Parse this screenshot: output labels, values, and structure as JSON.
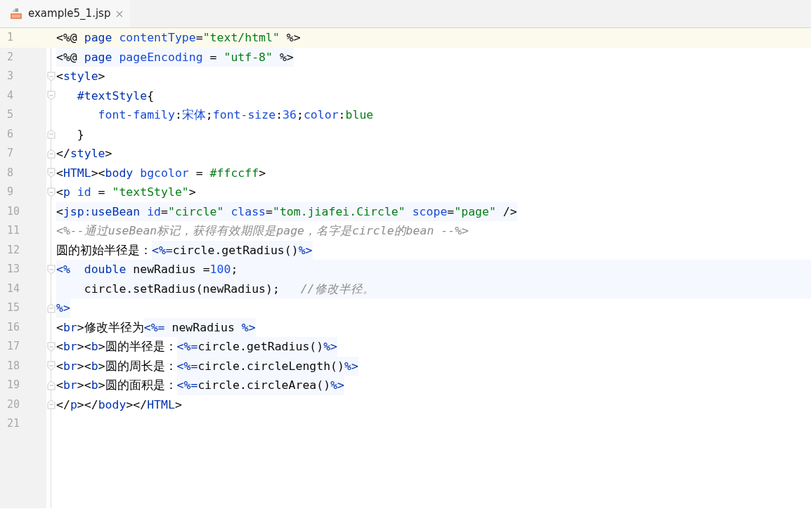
{
  "tabs": [
    {
      "label": "example5_1.jsp",
      "selected": true
    }
  ],
  "lines": [
    {
      "number": "1",
      "current": true,
      "block": false,
      "fold_start": false,
      "fold_end": false,
      "code": [
        {
          "text": "<%@ ",
          "kind": "plain"
        },
        {
          "text": "page ",
          "kind": "tag"
        },
        {
          "text": "contentType",
          "kind": "attr"
        },
        {
          "text": "=",
          "kind": "plain"
        },
        {
          "text": "\"text/html\"",
          "kind": "str"
        },
        {
          "text": " %>",
          "kind": "plain"
        }
      ]
    },
    {
      "number": "2",
      "current": false,
      "block": false,
      "fold_start": false,
      "fold_end": false,
      "injected": [
        {
          "text": "<%@ ",
          "kind": "plain"
        },
        {
          "text": "page ",
          "kind": "tag"
        },
        {
          "text": "pageEncoding",
          "kind": "attr"
        },
        {
          "text": " = ",
          "kind": "plain"
        },
        {
          "text": "\"utf-8\"",
          "kind": "str"
        },
        {
          "text": " %>",
          "kind": "plain"
        }
      ]
    },
    {
      "number": "3",
      "current": false,
      "block": false,
      "fold_start": true,
      "fold_end": false,
      "code": [
        {
          "text": "<",
          "kind": "plain"
        },
        {
          "text": "style",
          "kind": "tag"
        },
        {
          "text": ">",
          "kind": "plain"
        }
      ]
    },
    {
      "number": "4",
      "current": false,
      "block": false,
      "fold_start": true,
      "fold_end": false,
      "code": [
        {
          "text": "   #textStyle",
          "kind": "tag"
        },
        {
          "text": "{",
          "kind": "plain"
        }
      ]
    },
    {
      "number": "5",
      "current": false,
      "block": false,
      "fold_start": false,
      "fold_end": false,
      "code": [
        {
          "text": "      font-family",
          "kind": "attr"
        },
        {
          "text": ":",
          "kind": "plain"
        },
        {
          "text": "宋体",
          "kind": "attr"
        },
        {
          "text": ";",
          "kind": "plain"
        },
        {
          "text": "font-size",
          "kind": "attr"
        },
        {
          "text": ":",
          "kind": "plain"
        },
        {
          "text": "36",
          "kind": "num"
        },
        {
          "text": ";",
          "kind": "plain"
        },
        {
          "text": "color",
          "kind": "attr"
        },
        {
          "text": ":",
          "kind": "plain"
        },
        {
          "text": "blue",
          "kind": "str"
        }
      ]
    },
    {
      "number": "6",
      "current": false,
      "block": false,
      "fold_start": false,
      "fold_end": true,
      "code": [
        {
          "text": "   }",
          "kind": "plain"
        }
      ]
    },
    {
      "number": "7",
      "current": false,
      "block": false,
      "fold_start": false,
      "fold_end": true,
      "code": [
        {
          "text": "</",
          "kind": "plain"
        },
        {
          "text": "style",
          "kind": "tag"
        },
        {
          "text": ">",
          "kind": "plain"
        }
      ]
    },
    {
      "number": "8",
      "current": false,
      "block": false,
      "fold_start": true,
      "fold_end": false,
      "code": [
        {
          "text": "<",
          "kind": "plain"
        },
        {
          "text": "HTML",
          "kind": "tag"
        },
        {
          "text": "><",
          "kind": "plain"
        },
        {
          "text": "body ",
          "kind": "tag"
        },
        {
          "text": "bgcolor",
          "kind": "attr"
        },
        {
          "text": " = ",
          "kind": "plain"
        },
        {
          "text": "#ffccff",
          "kind": "str"
        },
        {
          "text": ">",
          "kind": "plain"
        }
      ]
    },
    {
      "number": "9",
      "current": false,
      "block": false,
      "fold_start": true,
      "fold_end": false,
      "code": [
        {
          "text": "<",
          "kind": "plain"
        },
        {
          "text": "p ",
          "kind": "tag"
        },
        {
          "text": "id",
          "kind": "attr"
        },
        {
          "text": " = ",
          "kind": "plain"
        },
        {
          "text": "\"textStyle\"",
          "kind": "str"
        },
        {
          "text": ">",
          "kind": "plain"
        }
      ]
    },
    {
      "number": "10",
      "current": false,
      "block": false,
      "fold_start": false,
      "fold_end": false,
      "injected": [
        {
          "text": "<",
          "kind": "plain"
        },
        {
          "text": "jsp:useBean ",
          "kind": "tag"
        },
        {
          "text": "id",
          "kind": "attr"
        },
        {
          "text": "=",
          "kind": "plain"
        },
        {
          "text": "\"circle\" ",
          "kind": "str"
        },
        {
          "text": "class",
          "kind": "attr"
        },
        {
          "text": "=",
          "kind": "plain"
        },
        {
          "text": "\"tom.jiafei.Circle\" ",
          "kind": "str"
        },
        {
          "text": "scope",
          "kind": "attr"
        },
        {
          "text": "=",
          "kind": "plain"
        },
        {
          "text": "\"page\"",
          "kind": "str"
        },
        {
          "text": " />",
          "kind": "plain"
        }
      ]
    },
    {
      "number": "11",
      "current": false,
      "block": false,
      "fold_start": false,
      "fold_end": false,
      "code": [
        {
          "text": "<%--通过useBean标记，获得有效期限是page，名字是circle的bean --%>",
          "kind": "comment"
        }
      ]
    },
    {
      "number": "12",
      "current": false,
      "block": false,
      "fold_start": false,
      "fold_end": false,
      "code": [
        {
          "text": "圆的初始半径是：",
          "kind": "plain"
        }
      ],
      "injected": [
        {
          "text": "<%=",
          "kind": "jsp"
        },
        {
          "text": "circle.getRadius()",
          "kind": "plain"
        },
        {
          "text": "%>",
          "kind": "jsp"
        }
      ]
    },
    {
      "number": "13",
      "current": false,
      "block": true,
      "fold_start": true,
      "fold_end": false,
      "code": [
        {
          "text": "<%  ",
          "kind": "jsp"
        },
        {
          "text": "double ",
          "kind": "tag"
        },
        {
          "text": "newRadius =",
          "kind": "plain"
        },
        {
          "text": "100",
          "kind": "num"
        },
        {
          "text": ";",
          "kind": "plain"
        }
      ]
    },
    {
      "number": "14",
      "current": false,
      "block": true,
      "fold_start": false,
      "fold_end": false,
      "code": [
        {
          "text": "    circle.setRadius(newRadius);   ",
          "kind": "plain"
        },
        {
          "text": "//修改半径。",
          "kind": "comment"
        }
      ]
    },
    {
      "number": "15",
      "current": false,
      "block": false,
      "fold_start": false,
      "fold_end": true,
      "injected": [
        {
          "text": "%>",
          "kind": "jsp"
        }
      ]
    },
    {
      "number": "16",
      "current": false,
      "block": false,
      "fold_start": false,
      "fold_end": false,
      "code": [
        {
          "text": "<",
          "kind": "plain"
        },
        {
          "text": "br",
          "kind": "tag"
        },
        {
          "text": ">修改半径为",
          "kind": "plain"
        }
      ],
      "injected": [
        {
          "text": "<%=",
          "kind": "jsp"
        },
        {
          "text": " newRadius ",
          "kind": "plain"
        },
        {
          "text": "%>",
          "kind": "jsp"
        }
      ]
    },
    {
      "number": "17",
      "current": false,
      "block": false,
      "fold_start": true,
      "fold_end": false,
      "code": [
        {
          "text": "<",
          "kind": "plain"
        },
        {
          "text": "br",
          "kind": "tag"
        },
        {
          "text": "><",
          "kind": "plain"
        },
        {
          "text": "b",
          "kind": "tag"
        },
        {
          "text": ">圆的半径是：",
          "kind": "plain"
        }
      ],
      "injected": [
        {
          "text": "<%=",
          "kind": "jsp"
        },
        {
          "text": "circle.getRadius()",
          "kind": "plain"
        },
        {
          "text": "%>",
          "kind": "jsp"
        }
      ]
    },
    {
      "number": "18",
      "current": false,
      "block": false,
      "fold_start": true,
      "fold_end": false,
      "code": [
        {
          "text": "<",
          "kind": "plain"
        },
        {
          "text": "br",
          "kind": "tag"
        },
        {
          "text": "><",
          "kind": "plain"
        },
        {
          "text": "b",
          "kind": "tag"
        },
        {
          "text": ">圆的周长是：",
          "kind": "plain"
        }
      ],
      "injected": [
        {
          "text": "<%=",
          "kind": "jsp"
        },
        {
          "text": "circle.circleLength()",
          "kind": "plain"
        },
        {
          "text": "%>",
          "kind": "jsp"
        }
      ]
    },
    {
      "number": "19",
      "current": false,
      "block": false,
      "fold_start": false,
      "fold_end": true,
      "code": [
        {
          "text": "<",
          "kind": "plain"
        },
        {
          "text": "br",
          "kind": "tag"
        },
        {
          "text": "><",
          "kind": "plain"
        },
        {
          "text": "b",
          "kind": "tag"
        },
        {
          "text": ">圆的面积是：",
          "kind": "plain"
        }
      ],
      "injected": [
        {
          "text": "<%=",
          "kind": "jsp"
        },
        {
          "text": "circle.circleArea()",
          "kind": "plain"
        },
        {
          "text": "%>",
          "kind": "jsp"
        }
      ]
    },
    {
      "number": "20",
      "current": false,
      "block": false,
      "fold_start": false,
      "fold_end": true,
      "code": [
        {
          "text": "</",
          "kind": "plain"
        },
        {
          "text": "p",
          "kind": "tag"
        },
        {
          "text": "></",
          "kind": "plain"
        },
        {
          "text": "body",
          "kind": "tag"
        },
        {
          "text": "></",
          "kind": "plain"
        },
        {
          "text": "HTML",
          "kind": "tag"
        },
        {
          "text": ">",
          "kind": "plain"
        }
      ]
    },
    {
      "number": "21",
      "current": false,
      "block": false,
      "fold_start": false,
      "fold_end": false
    }
  ]
}
